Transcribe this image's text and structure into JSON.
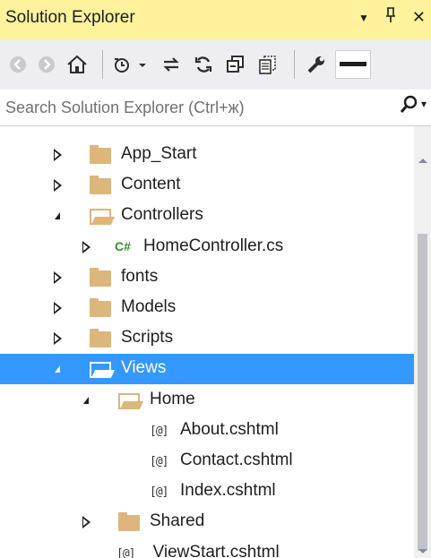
{
  "window": {
    "title": "Solution Explorer",
    "dropdown_glyph": "▼",
    "pin_glyph": "ᅟ",
    "close_glyph": "✕"
  },
  "toolbar": {
    "back_icon": "back-icon",
    "forward_icon": "forward-icon",
    "home_icon": "home-icon",
    "pending_changes_icon": "pending-changes-icon",
    "sync_icon": "sync-with-active-document-icon",
    "refresh_icon": "refresh-icon",
    "collapse_all_icon": "collapse-all-icon",
    "show_all_files_icon": "show-all-files-icon",
    "properties_icon": "properties-icon",
    "preview_icon": "preview-selected-items-icon"
  },
  "search": {
    "placeholder": "Search Solution Explorer (Ctrl+ж)"
  },
  "tree": {
    "items": [
      {
        "label": "App_Start",
        "type": "folder",
        "expander": "collapsed"
      },
      {
        "label": "Content",
        "type": "folder",
        "expander": "collapsed"
      },
      {
        "label": "Controllers",
        "type": "folder-open",
        "expander": "expanded"
      },
      {
        "label": "HomeController.cs",
        "type": "csharp",
        "expander": "collapsed",
        "icon_text": "C#"
      },
      {
        "label": "fonts",
        "type": "folder",
        "expander": "collapsed"
      },
      {
        "label": "Models",
        "type": "folder",
        "expander": "collapsed"
      },
      {
        "label": "Scripts",
        "type": "folder",
        "expander": "collapsed"
      },
      {
        "label": "Views",
        "type": "folder-open",
        "expander": "expanded",
        "selected": true
      },
      {
        "label": "Home",
        "type": "folder-open",
        "expander": "expanded"
      },
      {
        "label": "About.cshtml",
        "type": "cshtml",
        "icon_text": "[@]"
      },
      {
        "label": "Contact.cshtml",
        "type": "cshtml",
        "icon_text": "[@]"
      },
      {
        "label": "Index.cshtml",
        "type": "cshtml",
        "icon_text": "[@]"
      },
      {
        "label": "Shared",
        "type": "folder",
        "expander": "collapsed"
      },
      {
        "label": "_ViewStart.cshtml",
        "type": "cshtml",
        "icon_text": "[@]"
      }
    ]
  },
  "colors": {
    "title_bar": "#fff29d",
    "selection": "#3399ff",
    "folder": "#dcb67a",
    "csharp_icon": "#388a34"
  }
}
